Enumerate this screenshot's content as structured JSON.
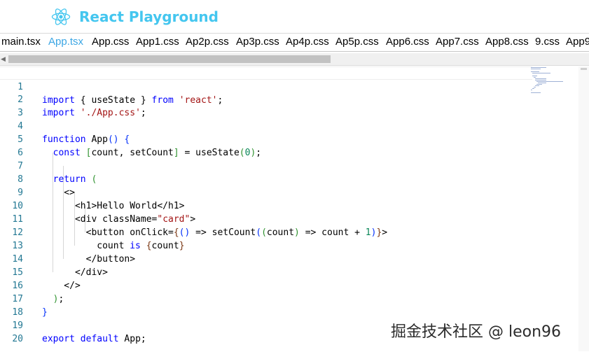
{
  "app": {
    "title": "React Playground",
    "logo_icon": "react-atom-icon",
    "accent_color": "#44c6ef",
    "active_tab_color": "#3ba6e4"
  },
  "tabs": [
    {
      "label": "main.tsx",
      "active": false
    },
    {
      "label": "App.tsx",
      "active": true
    },
    {
      "label": "App.css",
      "active": false
    },
    {
      "label": "App1.css",
      "active": false
    },
    {
      "label": "Ap2p.css",
      "active": false
    },
    {
      "label": "Ap3p.css",
      "active": false
    },
    {
      "label": "Ap4p.css",
      "active": false
    },
    {
      "label": "Ap5p.css",
      "active": false
    },
    {
      "label": "App6.css",
      "active": false
    },
    {
      "label": "App7.css",
      "active": false
    },
    {
      "label": "App8.css",
      "active": false
    },
    {
      "label": "9.css",
      "active": false
    },
    {
      "label": "App9",
      "active": false
    }
  ],
  "editor": {
    "lines": [
      {
        "n": "1",
        "code": "import { useState } from 'react';"
      },
      {
        "n": "2",
        "code": "import './App.css';"
      },
      {
        "n": "3",
        "code": ""
      },
      {
        "n": "4",
        "code": "function App() {"
      },
      {
        "n": "5",
        "code": "  const [count, setCount] = useState(0);"
      },
      {
        "n": "6",
        "code": ""
      },
      {
        "n": "7",
        "code": "  return ("
      },
      {
        "n": "8",
        "code": "    <>"
      },
      {
        "n": "9",
        "code": "      <h1>Hello World</h1>"
      },
      {
        "n": "10",
        "code": "      <div className=\"card\">"
      },
      {
        "n": "11",
        "code": "        <button onClick={() => setCount((count) => count + 1)}>"
      },
      {
        "n": "12",
        "code": "          count is {count}"
      },
      {
        "n": "13",
        "code": "        </button>"
      },
      {
        "n": "14",
        "code": "      </div>"
      },
      {
        "n": "15",
        "code": "    </>"
      },
      {
        "n": "16",
        "code": "  );"
      },
      {
        "n": "17",
        "code": "}"
      },
      {
        "n": "18",
        "code": ""
      },
      {
        "n": "19",
        "code": "export default App;"
      },
      {
        "n": "20",
        "code": ""
      }
    ]
  },
  "watermark": "掘金技术社区 @ leon96"
}
